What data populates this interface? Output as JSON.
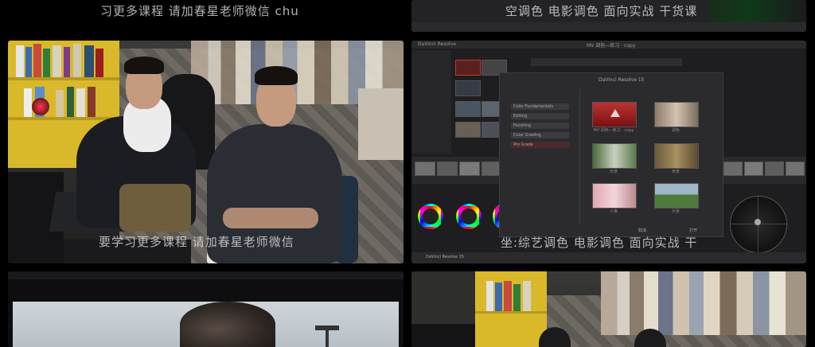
{
  "captions": {
    "top_left": "习更多课程 请加春星老师微信 chu",
    "top_right": "空调色 电影调色 面向实战 干货课",
    "mid_left": "要学习更多课程 请加春星老师微信",
    "mid_right": "坐:综艺调色 电影调色 面向实战 干"
  },
  "resolve": {
    "app_title": "DaVinci Resolve",
    "project_title": "MV 调色—练习 · copy",
    "dialog_title": "DaVinci Resolve 15",
    "list_items": [
      "Color Fundamentals",
      "Editing",
      "Finishing",
      "Color Grading",
      "Pro Grade"
    ],
    "thumb_labels": [
      "MV 调色—练习 · copy",
      "调色",
      "日景",
      "夜景",
      "人像",
      "外景"
    ],
    "status": "DaVinci Resolve 15",
    "btn_cancel": "取消",
    "btn_open": "打开"
  },
  "colors": {
    "resolve_bg": "#1e1e20",
    "accent_red": "#c0392b",
    "shelf_yellow": "#d9b92a"
  }
}
